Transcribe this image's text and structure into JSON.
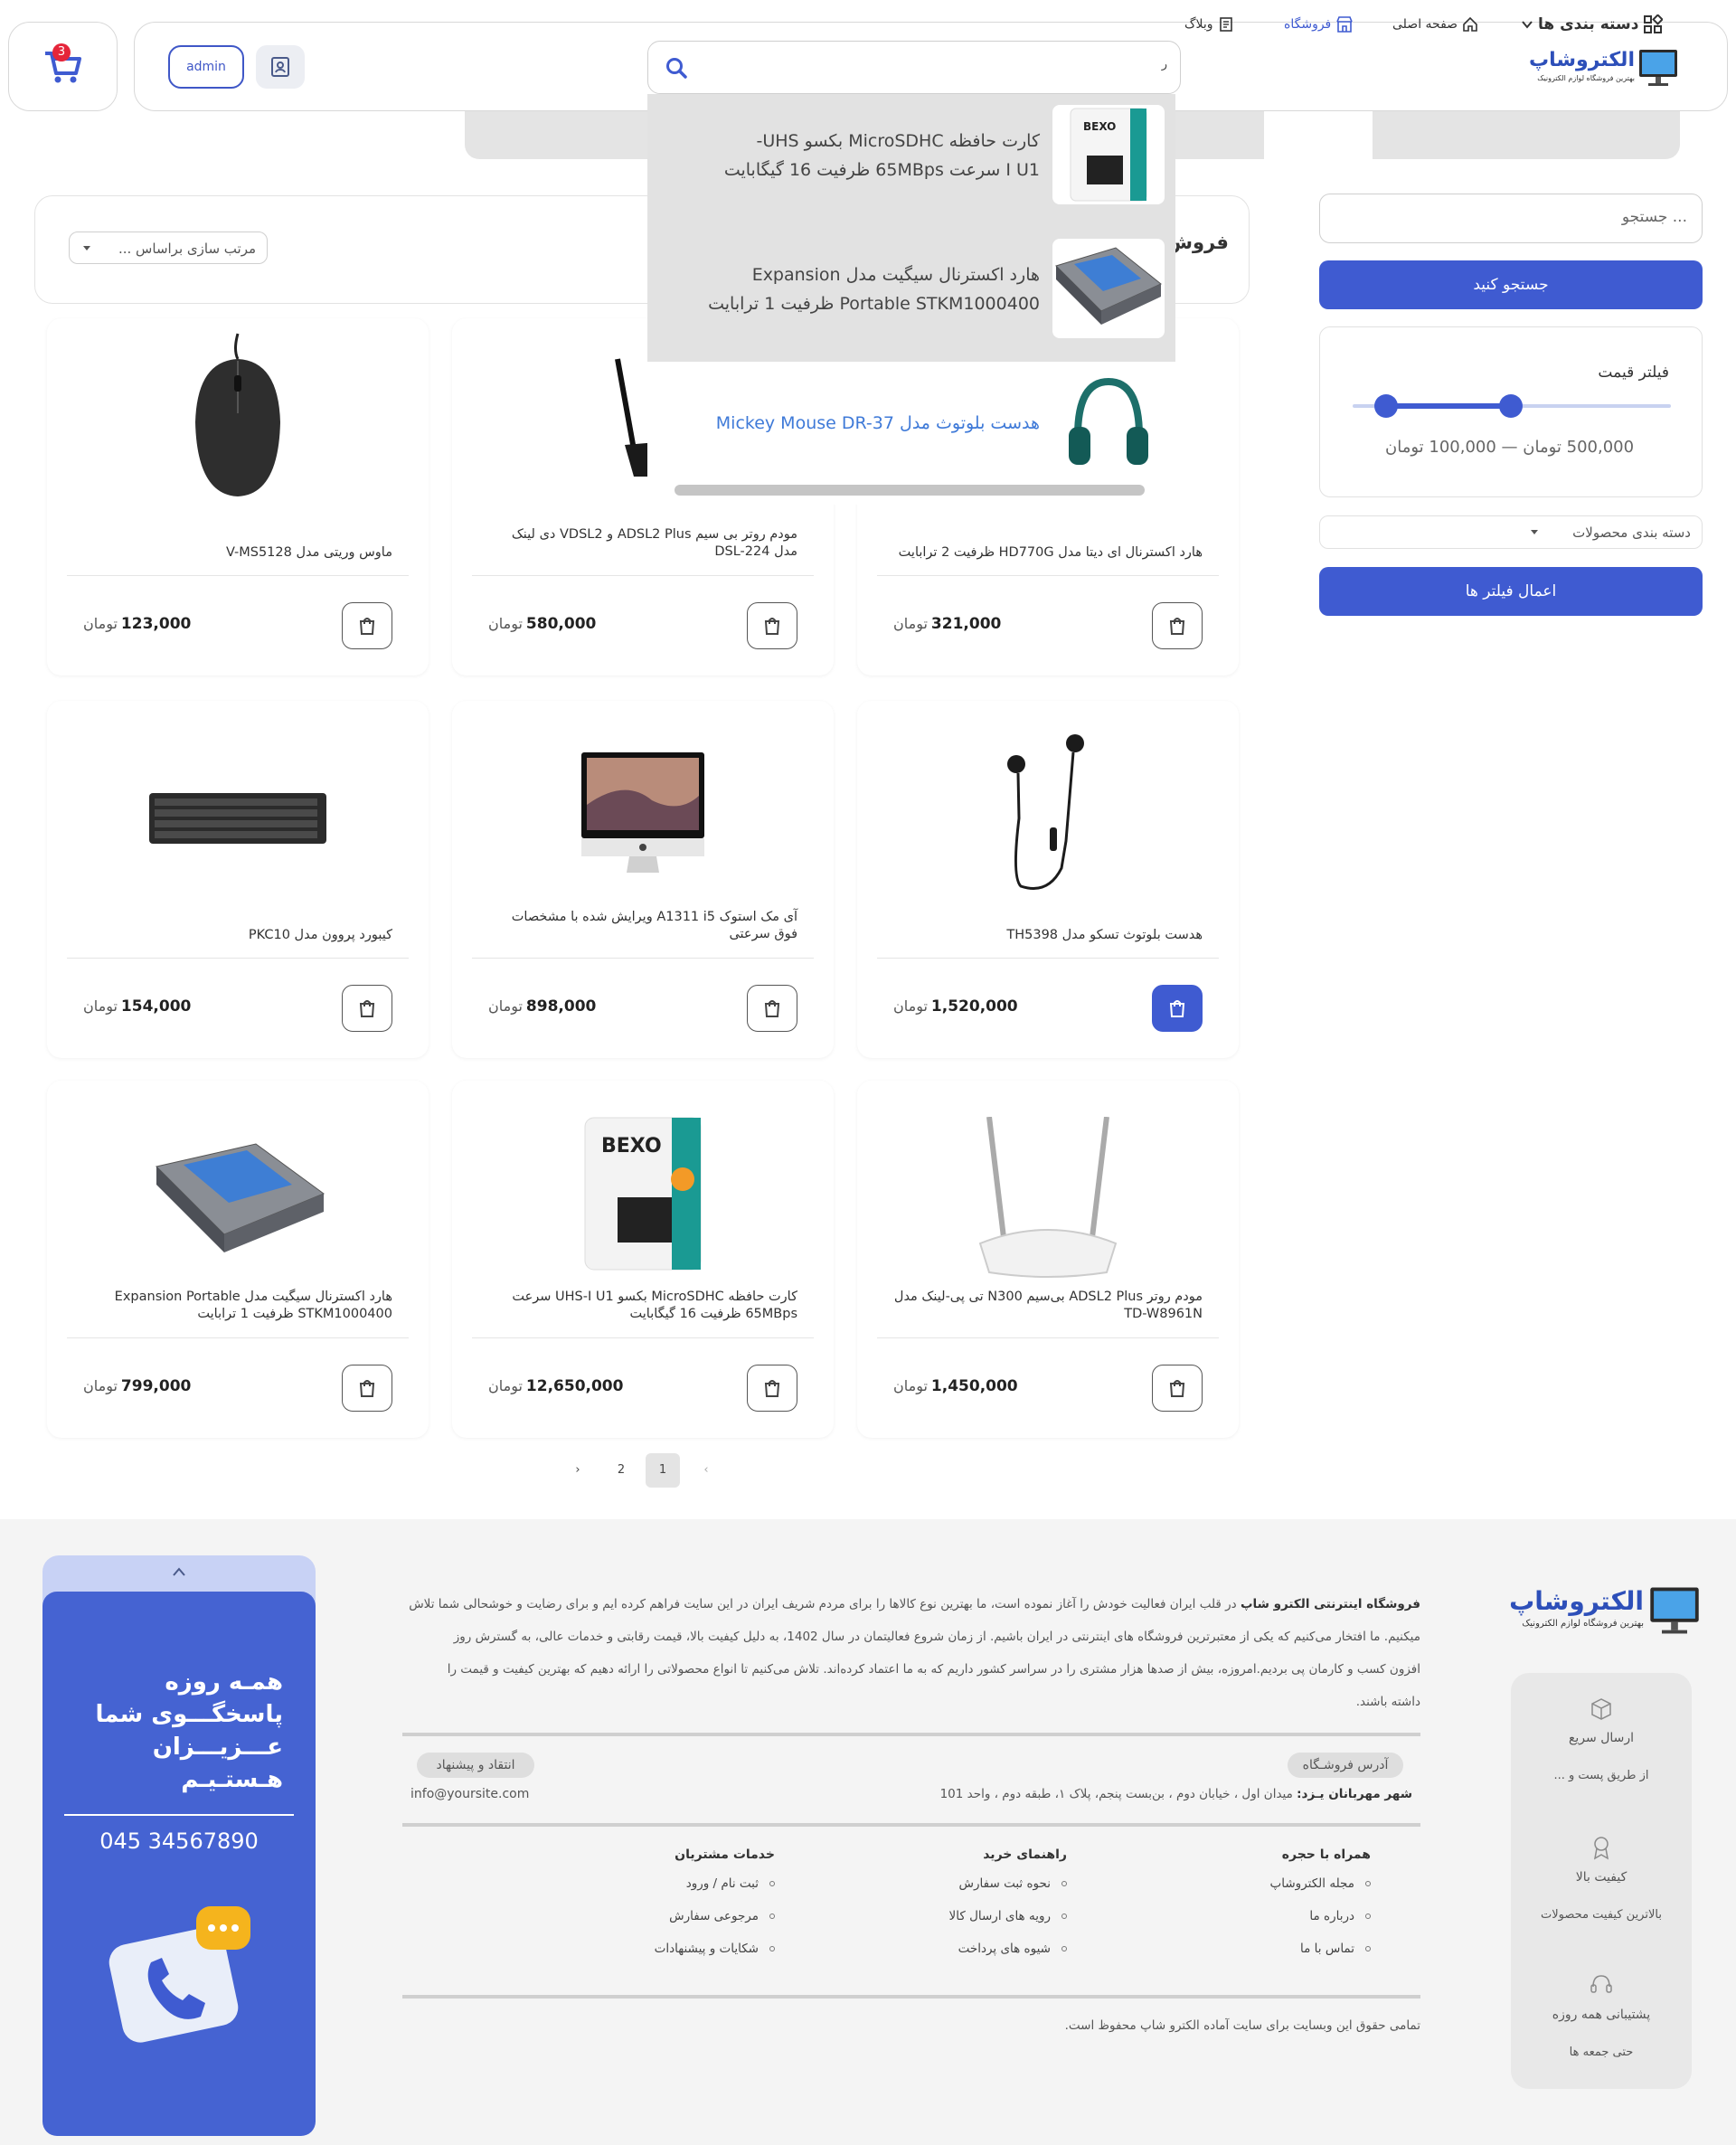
{
  "header": {
    "logo_title": "الکتروشاپ",
    "logo_subtitle": "بهترین فروشگاه لوازم الکترونیک",
    "search_value": "ر",
    "admin_label": "admin",
    "cart_count": "3"
  },
  "nav": {
    "categories": "دسته بندی ها",
    "home": "صفحه اصلی",
    "shop": "فروشگاه",
    "blog": "وبلاگ"
  },
  "search_dropdown": {
    "items": [
      {
        "line1": "کارت حافظه MicroSDHC بکسو UHS-",
        "line2": "I U1 سرعت 65MBps ظرفیت 16 گیگابایت",
        "icon": "memory-card"
      },
      {
        "line1": "هارد اکسترنال سیگیت مدل Expansion",
        "line2": "Portable STKM1000400 ظرفیت 1 ترابایت",
        "icon": "hard-drive"
      },
      {
        "line1": "هدست بلوتوث مدل Mickey Mouse DR-37",
        "line2": "",
        "icon": "headphones"
      }
    ]
  },
  "sidebar": {
    "search_placeholder": "جستجو ...",
    "search_button": "جستجو کنید",
    "price_filter_title": "فیلتر قیمت",
    "price_range_text": "500,000 تومان — 100,000 تومان",
    "price_min": 100000,
    "price_max": 500000,
    "category_select": "دسته بندی محصولات",
    "apply_button": "اعمال فیلتر ها"
  },
  "shop": {
    "title_partial": "فروش",
    "sort_label": "مرتب سازی براساس ..."
  },
  "products": [
    {
      "title": "هارد اکسترنال ای دیتا مدل HD770G ظرفیت 2 ترابایت",
      "price": "321,000",
      "currency": "تومان",
      "icon": "hard-drive-gaming"
    },
    {
      "title": "مودم روتر بی سیم ADSL2 Plus و VDSL2 دی لینک مدل DSL-224",
      "price": "580,000",
      "currency": "تومان",
      "icon": "router"
    },
    {
      "title": "ماوس وریتی مدل V-MS5128",
      "price": "123,000",
      "currency": "تومان",
      "icon": "mouse"
    },
    {
      "title": "هدست بلوتوث تسکو مدل TH5398",
      "price": "1,520,000",
      "currency": "تومان",
      "icon": "earphones"
    },
    {
      "title": "آی مک استوک A1311 i5 ویرایش شده با مشخصات فوق سرعتی",
      "price": "898,000",
      "currency": "تومان",
      "icon": "imac"
    },
    {
      "title": "کیبورد پروون مدل PKC10",
      "price": "154,000",
      "currency": "تومان",
      "icon": "keyboard"
    },
    {
      "title": "مودم روتر ADSL2 Plus بی‌سیم N300 تی پی-لینک مدل TD-W8961N",
      "price": "1,450,000",
      "currency": "تومان",
      "icon": "router-white"
    },
    {
      "title": "کارت حافظه MicroSDHC بکسو UHS-I U1 سرعت 65MBps ظرفیت 16 گیگابایت",
      "price": "12,650,000",
      "currency": "تومان",
      "icon": "memory-card"
    },
    {
      "title": "هارد اکسترنال سیگیت مدل Expansion Portable STKM1000400 ظرفیت 1 ترابایت",
      "price": "799,000",
      "currency": "تومان",
      "icon": "hard-drive"
    }
  ],
  "pagination": {
    "pages": [
      "1",
      "2"
    ],
    "current": "1"
  },
  "footer": {
    "logo_title": "الکتروشاپ",
    "logo_subtitle": "بهترین فروشگاه لوازم الکترونیک",
    "about_bold": "فروشگاه اینترنتی الکترو شاپ",
    "about_line1": " در قلب ایران فعالیت خودش را آغاز نموده است، ما بهترین نوع کالاها را برای مردم شریف ایران در این سایت فراهم کرده ایم و برای رضایت و خوشحالی شما تلاش",
    "about_line2": "میکنیم. ما افتخار می‌کنیم که یکی از معتبرترین فروشگاه های اینترنتی در ایران باشیم. از زمان شروع فعالیتمان در سال 1402، به دلیل کیفیت بالا، قیمت رقابتی و خدمات عالی، به گسترش روز",
    "about_line3": "افزون کسب و کارمان پی بردیم.امروزه، بیش از صدها هزار مشتری را در سراسر کشور داریم که به ما اعتماد کرده‌اند. تلاش می‌کنیم تا انواع محصولاتی را ارائه دهیم که بهترین کیفیت و قیمت را",
    "about_line4": "داشته باشند.",
    "address_pill": "آدرس فروشـگاه",
    "address_city": "شهر مهربانان یـزد:",
    "address_text": " میدان اول ، خیابان دوم ، بن‌بست پنجم، پلاک ۱، طبقه دوم ، واحد 101",
    "feedback_pill": "انتقاد و پیشنهاد",
    "email": "info@yoursite.com",
    "col1_title": "همراه با حجره",
    "col1_links": [
      "مجله الکتروشاپ",
      "درباره ما",
      "تماس با ما"
    ],
    "col2_title": "راهنمای خرید",
    "col2_links": [
      "نحوه ثبت سفارش",
      "رویه های ارسال کالا",
      "شیوه های پرداخت"
    ],
    "col3_title": "خدمات مشتریان",
    "col3_links": [
      "ثبت نام / ورود",
      "مرجوعی سفارش",
      "شکایات و پیشنهادات"
    ],
    "copyright": "تمامی حقوق این وبسایت برای سایت آماده الکترو شاپ محفوظ است.",
    "features": [
      {
        "title": "ارسال سریع",
        "sub": "از طریق پست و ..."
      },
      {
        "title": "کیفیت بالا",
        "sub": "بالاترین کیفیت محصولات"
      },
      {
        "title": "پشتیبانی همه روزه",
        "sub": "حتی جمعه ها"
      }
    ],
    "support_line1": "همـه روزه",
    "support_line2": "پاسخگـــوی شما",
    "support_line3": "عـــزیـــزان",
    "support_line4": "هـستـیـم",
    "support_phone": "045 34567890"
  },
  "colors": {
    "accent": "#3f5bd1",
    "badge": "#e5253a",
    "logo": "#2d4fb9"
  }
}
